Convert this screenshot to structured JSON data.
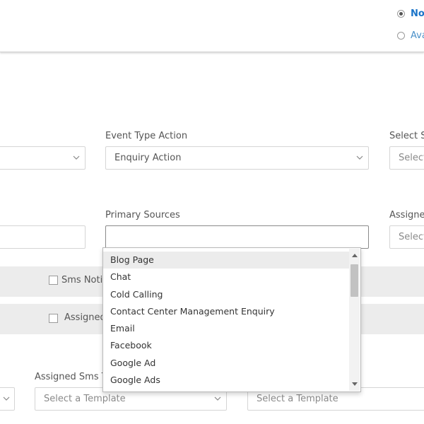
{
  "header": {
    "radio_options": [
      {
        "label": "No",
        "checked": true
      },
      {
        "label": "Ava",
        "checked": false
      }
    ]
  },
  "row1": {
    "event_type_action_label": "Event Type Action",
    "event_type_action_value": "Enquiry Action",
    "select_right_label": "Select S",
    "select_right_placeholder": "Select"
  },
  "row2": {
    "primary_sources_label": "Primary Sources",
    "primary_sources_value": "",
    "assigned_right_label": "Assigne",
    "assigned_right_placeholder": "Select"
  },
  "bands": {
    "sms_label": "Sms Noti",
    "assigned_label": "Assigned"
  },
  "row3": {
    "assigned_sms_label": "Assigned Sms T",
    "template_placeholder_1": "Select a Template",
    "template_placeholder_2": "Select a Template"
  },
  "dropdown": {
    "items": [
      "Blog Page",
      "Chat",
      "Cold Calling",
      "Contact Center Management Enquiry",
      "Email",
      "Facebook",
      "Google Ad",
      "Google Ads"
    ],
    "highlighted_index": 0
  },
  "colors": {
    "accent": "#1a73c8",
    "band": "#ececec",
    "border": "#d5d5d5"
  }
}
